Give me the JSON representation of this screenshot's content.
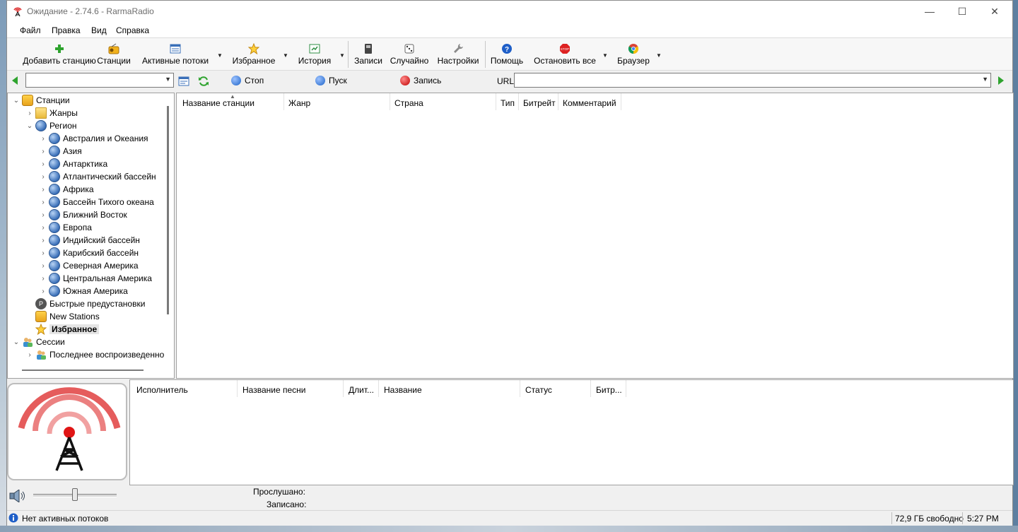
{
  "window": {
    "title": "Ожидание - 2.74.6 - RarmaRadio",
    "controls": {
      "minimize": "—",
      "maximize": "☐",
      "close": "✕"
    }
  },
  "menu": [
    "Файл",
    "Правка",
    "Вид",
    "Справка"
  ],
  "toolbar": {
    "add_station": "Добавить станцию",
    "stations": "Станции",
    "active_streams": "Активные потоки",
    "favorites": "Избранное",
    "history": "История",
    "recordings": "Записи",
    "random": "Случайно",
    "settings": "Настройки",
    "help": "Помощь",
    "stop_all": "Остановить все",
    "browser": "Браузер"
  },
  "controls_row": {
    "stop": "Стоп",
    "play": "Пуск",
    "record": "Запись",
    "url_label": "URL",
    "search_value": "",
    "url_value": ""
  },
  "tree": {
    "stations": "Станции",
    "genres": "Жанры",
    "region": "Регион",
    "regions": [
      "Австралия и Океания",
      "Азия",
      "Антарктика",
      "Атлантический бассейн",
      "Африка",
      "Бассейн Тихого океана",
      "Ближний Восток",
      "Европа",
      "Индийский бассейн",
      "Карибский бассейн",
      "Северная Америка",
      "Центральная Америка",
      "Южная Америка"
    ],
    "presets": "Быстрые предустановки",
    "new_stations": "New Stations",
    "favorites": "Избранное",
    "sessions": "Сессии",
    "last_played": "Последнее воспроизведенно"
  },
  "station_columns": [
    "Название станции",
    "Жанр",
    "Страна",
    "Тип",
    "Битрейт",
    "Комментарий"
  ],
  "track_columns": [
    "Исполнитель",
    "Название песни",
    "Длит...",
    "Название",
    "Статус",
    "Битр..."
  ],
  "volume": 50,
  "info": {
    "listened_label": "Прослушано:",
    "recorded_label": "Записано:"
  },
  "statusbar": {
    "message": "Нет активных потоков",
    "disk_free": "72,9 ГБ свободно",
    "time": "5:27 PM"
  },
  "colors": {
    "accent": "#1f6fd6",
    "record_red": "#d00000",
    "stop_blue": "#1e64c8"
  }
}
